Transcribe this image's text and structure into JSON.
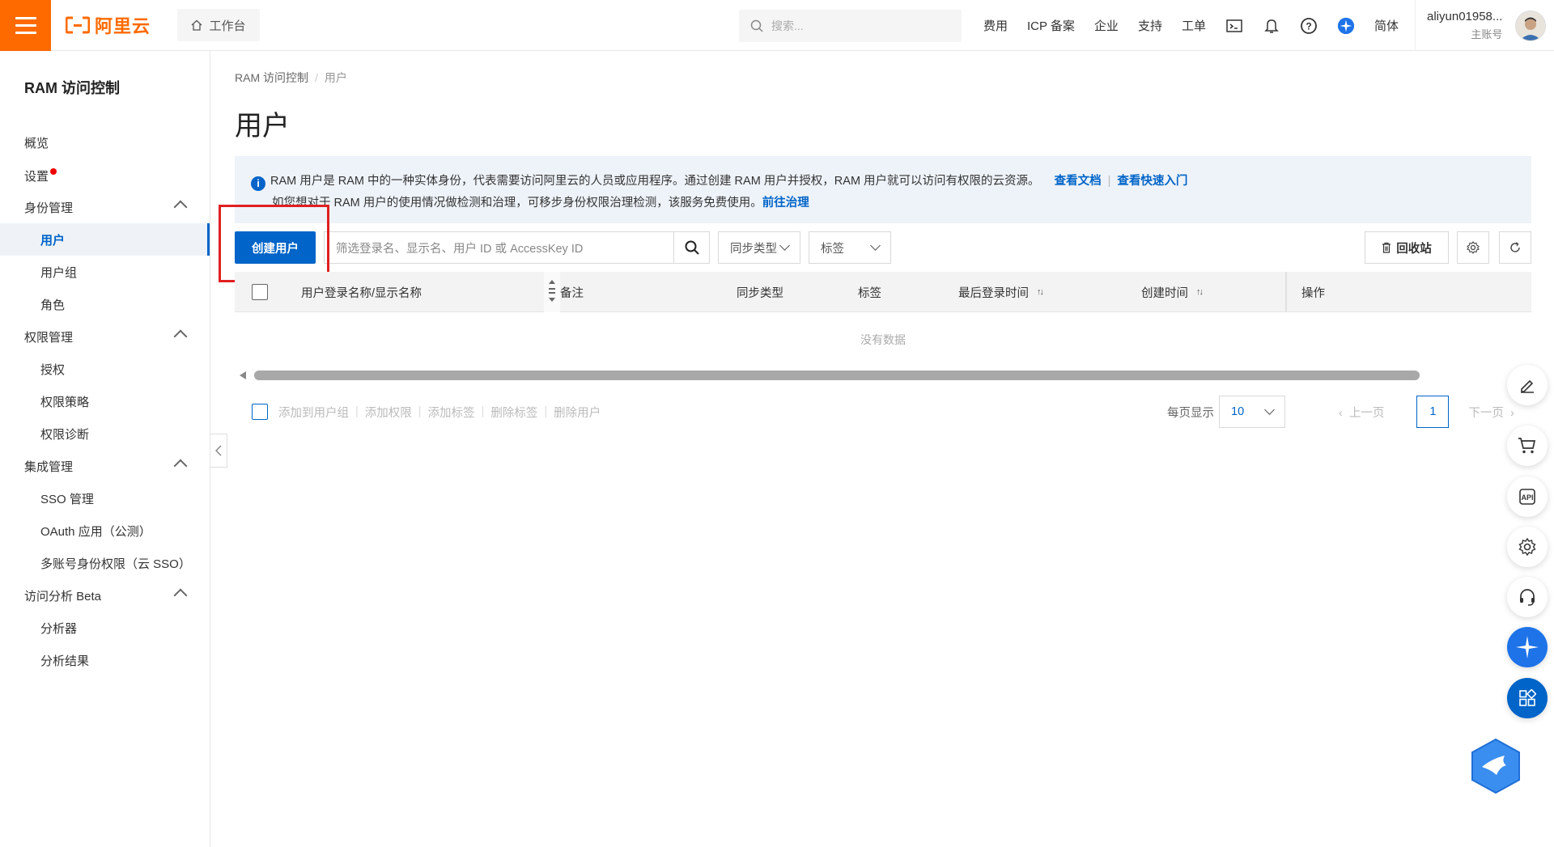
{
  "topbar": {
    "logo_text": "阿里云",
    "workbench": "工作台",
    "search_placeholder": "搜索...",
    "nav": [
      "费用",
      "ICP 备案",
      "企业",
      "支持",
      "工单"
    ],
    "lang": "简体",
    "user_name": "aliyun01958...",
    "user_role": "主账号"
  },
  "sidebar": {
    "title": "RAM 访问控制",
    "items": [
      "概览",
      "设置",
      "身份管理",
      "用户",
      "用户组",
      "角色",
      "权限管理",
      "授权",
      "权限策略",
      "权限诊断",
      "集成管理",
      "SSO 管理",
      "OAuth 应用（公测）",
      "多账号身份权限（云 SSO）",
      "访问分析 Beta",
      "分析器",
      "分析结果"
    ]
  },
  "breadcrumb": {
    "root": "RAM 访问控制",
    "current": "用户"
  },
  "page_title": "用户",
  "notice": {
    "line1": "RAM 用户是 RAM 中的一种实体身份，代表需要访问阿里云的人员或应用程序。通过创建 RAM 用户并授权，RAM 用户就可以访问有权限的云资源。",
    "link_docs": "查看文档",
    "link_quickstart": "查看快速入门",
    "line2": "如您想对于 RAM 用户的使用情况做检测和治理，可移步身份权限治理检测，该服务免费使用。",
    "link_governance": "前往治理"
  },
  "toolbar": {
    "create_user": "创建用户",
    "filter_placeholder": "筛选登录名、显示名、用户 ID 或 AccessKey ID",
    "sync_type": "同步类型",
    "tags": "标签",
    "recycle": "回收站"
  },
  "table": {
    "columns": [
      "用户登录名称/显示名称",
      "备注",
      "同步类型",
      "标签",
      "最后登录时间",
      "创建时间",
      "操作"
    ],
    "empty_text": "没有数据"
  },
  "footer": {
    "batch_actions": [
      "添加到用户组",
      "添加权限",
      "添加标签",
      "删除标签",
      "删除用户"
    ],
    "page_size_label": "每页显示",
    "page_size": "10",
    "prev": "上一页",
    "current_page": "1",
    "next": "下一页"
  },
  "colors": {
    "accent": "#0064c8",
    "brand": "#ff6a00",
    "highlight": "#e02020"
  }
}
